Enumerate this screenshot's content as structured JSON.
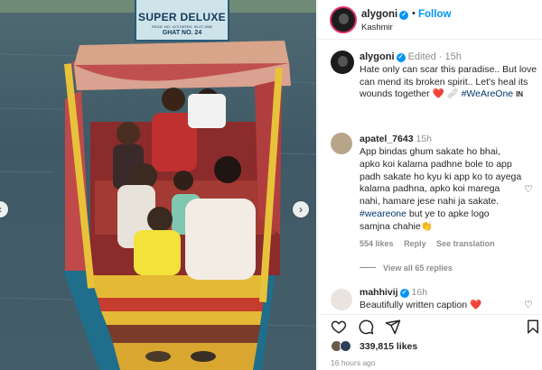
{
  "photo": {
    "sign": {
      "line1": "SUPER DELUXE",
      "line2": "REGD. NO.: 673     DATED: 30-07-1982",
      "line3": "GHAT NO. 24"
    }
  },
  "header": {
    "username": "alygoni",
    "follow_label": "Follow",
    "location": "Kashmir"
  },
  "caption": {
    "username": "alygoni",
    "meta": "Edited · 15h",
    "text_main": "Hate only can scar this paradise.. But love can mend its broken spirit.. Let's heal its wounds together ",
    "emoji": "❤️ 🩹",
    "hashtag": "#WeAreOne",
    "tag_suffix": "IN"
  },
  "comments": [
    {
      "username": "apatel_7643",
      "time": "15h",
      "text_main": "App bindas ghum sakate ho bhai, apko koi kalama padhne bole to app padh sakate ho kyu ki app ko to ayega kalama padhna, apko koi marega nahi, hamare jese nahi ja sakate. ",
      "hashtag": "#weareone",
      "text_end": " but ye to apke logo samjna chahie👏",
      "likes": "554 likes",
      "reply": "Reply",
      "translate": "See translation"
    },
    {
      "username": "mahhivij",
      "time": "16h",
      "text": "Beautifully written caption ❤️"
    }
  ],
  "view_replies": "View all 65 replies",
  "likes": {
    "count": "339,815",
    "suffix": " likes"
  },
  "timestamp": "16 hours ago",
  "colors": {
    "accent": "#0095f6",
    "heart": "#ed4956",
    "boat_yellow": "#e8c23a",
    "canopy_red": "#b0383a"
  }
}
